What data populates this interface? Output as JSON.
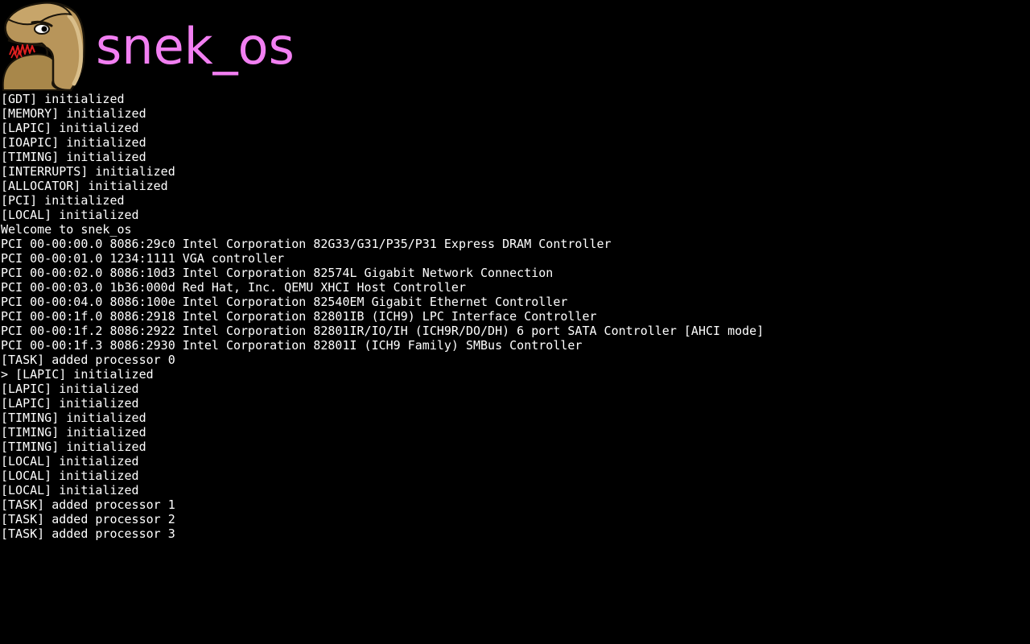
{
  "header": {
    "title": "snek_os",
    "logo_icon": "snake-logo-icon"
  },
  "colors": {
    "background": "#000000",
    "title": "#f27ff2",
    "console_text": "#ffffff"
  },
  "console": {
    "lines": [
      "[GDT] initialized",
      "[MEMORY] initialized",
      "[LAPIC] initialized",
      "[IOAPIC] initialized",
      "[TIMING] initialized",
      "[INTERRUPTS] initialized",
      "[ALLOCATOR] initialized",
      "[PCI] initialized",
      "[LOCAL] initialized",
      "Welcome to snek_os",
      "PCI 00-00:00.0 8086:29c0 Intel Corporation 82G33/G31/P35/P31 Express DRAM Controller",
      "PCI 00-00:01.0 1234:1111 VGA controller",
      "PCI 00-00:02.0 8086:10d3 Intel Corporation 82574L Gigabit Network Connection",
      "PCI 00-00:03.0 1b36:000d Red Hat, Inc. QEMU XHCI Host Controller",
      "PCI 00-00:04.0 8086:100e Intel Corporation 82540EM Gigabit Ethernet Controller",
      "PCI 00-00:1f.0 8086:2918 Intel Corporation 82801IB (ICH9) LPC Interface Controller",
      "PCI 00-00:1f.2 8086:2922 Intel Corporation 82801IR/IO/IH (ICH9R/DO/DH) 6 port SATA Controller [AHCI mode]",
      "PCI 00-00:1f.3 8086:2930 Intel Corporation 82801I (ICH9 Family) SMBus Controller",
      "[TASK] added processor 0",
      "> [LAPIC] initialized",
      "[LAPIC] initialized",
      "[LAPIC] initialized",
      "[TIMING] initialized",
      "[TIMING] initialized",
      "[TIMING] initialized",
      "[LOCAL] initialized",
      "[LOCAL] initialized",
      "[LOCAL] initialized",
      "[TASK] added processor 1",
      "[TASK] added processor 2",
      "[TASK] added processor 3"
    ]
  }
}
